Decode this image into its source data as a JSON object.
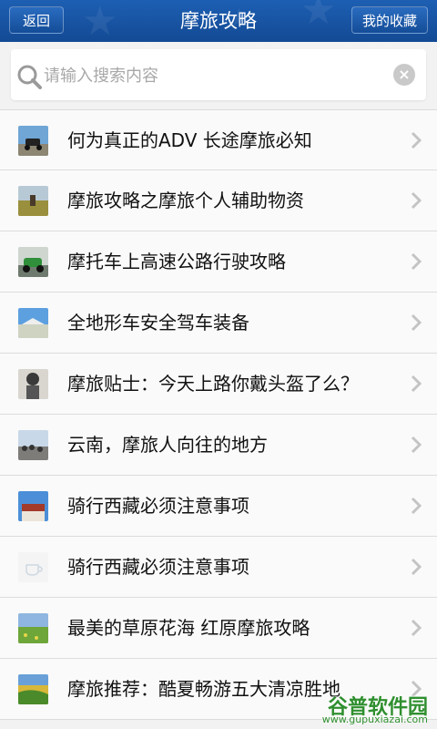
{
  "header": {
    "title": "摩旅攻略",
    "back_label": "返回",
    "favorites_label": "我的收藏",
    "bg_color": "#1a559f"
  },
  "search": {
    "placeholder": "请输入搜索内容",
    "value": ""
  },
  "list": {
    "items": [
      {
        "label": "何为真正的ADV 长途摩旅必知",
        "thumb": "motorcycle-rider"
      },
      {
        "label": "摩旅攻略之摩旅个人辅助物资",
        "thumb": "grassland-rider"
      },
      {
        "label": "摩托车上高速公路行驶攻略",
        "thumb": "motorcycle-green"
      },
      {
        "label": "全地形车安全驾车装备",
        "thumb": "sky-building"
      },
      {
        "label": "摩旅贴士：今天上路你戴头盔了么？",
        "thumb": "helmet-rider"
      },
      {
        "label": "云南，摩旅人向往的地方",
        "thumb": "crowd-square"
      },
      {
        "label": "骑行西藏必须注意事项",
        "thumb": "tibet-temple"
      },
      {
        "label": "骑行西藏必须注意事项",
        "thumb": "placeholder-cup"
      },
      {
        "label": "最美的草原花海 红原摩旅攻略",
        "thumb": "flower-field"
      },
      {
        "label": "摩旅推荐：酷夏畅游五大清凉胜地",
        "thumb": "terrace-field"
      }
    ]
  },
  "watermark": {
    "text": "谷普软件园",
    "url": "www.gupuxiazai.com"
  }
}
